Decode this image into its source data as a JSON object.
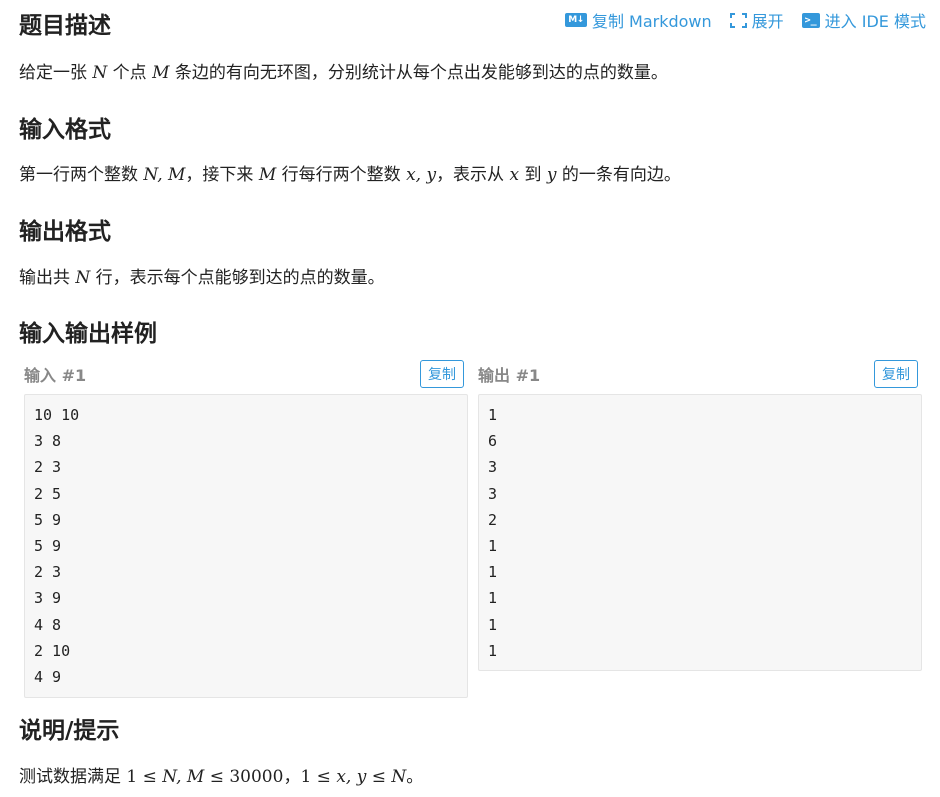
{
  "toolbar": {
    "copy_markdown": "复制 Markdown",
    "expand": "展开",
    "ide_mode": "进入 IDE 模式",
    "md_icon_text": "M↓",
    "term_icon_text": ">_",
    "accent_color": "#3498db"
  },
  "sections": {
    "description": {
      "title": "题目描述",
      "parts": [
        "给定一张 ",
        "N",
        " 个点 ",
        "M",
        " 条边的有向无环图，分别统计从每个点出发能够到达的点的数量。"
      ]
    },
    "input_format": {
      "title": "输入格式",
      "parts": [
        "第一行两个整数 ",
        "N, M",
        "，接下来 ",
        "M",
        " 行每行两个整数 ",
        "x, y",
        "，表示从 ",
        "x",
        " 到 ",
        "y",
        " 的一条有向边。"
      ]
    },
    "output_format": {
      "title": "输出格式",
      "parts": [
        "输出共 ",
        "N",
        " 行，表示每个点能够到达的点的数量。"
      ]
    },
    "samples": {
      "title": "输入输出样例",
      "input_label": "输入 #1",
      "output_label": "输出 #1",
      "copy_label": "复制",
      "input_lines": [
        "10 10",
        "3 8",
        "2 3",
        "2 5",
        "5 9",
        "5 9",
        "2 3",
        "3 9",
        "4 8",
        "2 10",
        "4 9"
      ],
      "output_lines": [
        "1",
        "6",
        "3",
        "3",
        "2",
        "1",
        "1",
        "1",
        "1",
        "1"
      ]
    },
    "hint": {
      "title": "说明/提示",
      "parts": [
        "测试数据满足 ",
        "1 ≤ ",
        "N, M",
        " ≤ 30000",
        "，",
        "1 ≤ ",
        "x, y",
        " ≤ ",
        "N",
        "。"
      ]
    }
  }
}
